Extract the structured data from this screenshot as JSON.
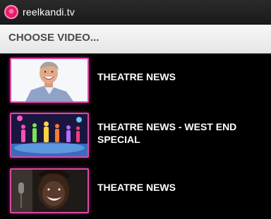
{
  "app": {
    "brand": "reelkandi.tv"
  },
  "header": {
    "title": "CHOOSE VIDEO..."
  },
  "videos": [
    {
      "title": "THEATRE NEWS"
    },
    {
      "title": "THEATRE NEWS - WEST END SPECIAL"
    },
    {
      "title": "THEATRE NEWS"
    }
  ],
  "colors": {
    "accent": "#e045a6",
    "background": "#000000",
    "header_bg": "#eeeeee",
    "brand_icon": "#e91e63"
  },
  "icons": {
    "logo": "reelkandi-logo-icon"
  }
}
